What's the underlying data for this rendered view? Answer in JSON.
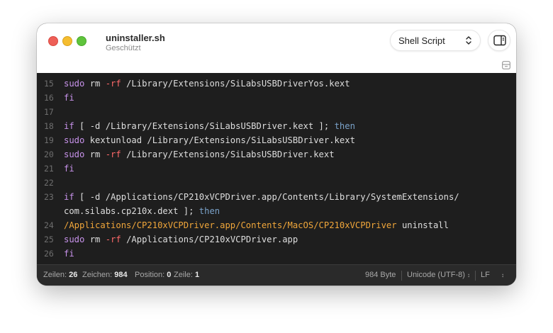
{
  "window": {
    "title": "uninstaller.sh",
    "subtitle": "Geschützt"
  },
  "toolbar": {
    "language": "Shell Script",
    "chevron_icon": "up-down-chevron-icon",
    "sidebar_icon": "sidebar-toggle-icon"
  },
  "editor": {
    "lines": [
      {
        "num": "15",
        "tokens": [
          [
            "kw",
            "sudo"
          ],
          [
            "txt",
            " rm "
          ],
          [
            "opt",
            "-rf"
          ],
          [
            "txt",
            " /Library/Extensions/SiLabsUSBDriverYos.kext"
          ]
        ]
      },
      {
        "num": "16",
        "tokens": [
          [
            "kw",
            "fi"
          ]
        ]
      },
      {
        "num": "17",
        "tokens": []
      },
      {
        "num": "18",
        "tokens": [
          [
            "kw",
            "if"
          ],
          [
            "txt",
            " [ -d /Library/Extensions/SiLabsUSBDriver.kext ]; "
          ],
          [
            "kw2",
            "then"
          ]
        ]
      },
      {
        "num": "19",
        "tokens": [
          [
            "kw",
            "sudo"
          ],
          [
            "txt",
            " kextunload /Library/Extensions/SiLabsUSBDriver.kext"
          ]
        ]
      },
      {
        "num": "20",
        "tokens": [
          [
            "kw",
            "sudo"
          ],
          [
            "txt",
            " rm "
          ],
          [
            "opt",
            "-rf"
          ],
          [
            "txt",
            " /Library/Extensions/SiLabsUSBDriver.kext"
          ]
        ]
      },
      {
        "num": "21",
        "tokens": [
          [
            "kw",
            "fi"
          ]
        ]
      },
      {
        "num": "22",
        "tokens": []
      },
      {
        "num": "23",
        "tokens": [
          [
            "kw",
            "if"
          ],
          [
            "txt",
            " [ -d /Applications/CP210xVCPDriver.app/Contents/Library/SystemExtensions/"
          ]
        ]
      },
      {
        "num": "",
        "tokens": [
          [
            "txt",
            "com.silabs.cp210x.dext ]; "
          ],
          [
            "kw2",
            "then"
          ]
        ]
      },
      {
        "num": "24",
        "tokens": [
          [
            "cmd",
            "/Applications/CP210xVCPDriver.app/Contents/MacOS/CP210xVCPDriver"
          ],
          [
            "txt",
            " uninstall"
          ]
        ]
      },
      {
        "num": "25",
        "tokens": [
          [
            "kw",
            "sudo"
          ],
          [
            "txt",
            " rm "
          ],
          [
            "opt",
            "-rf"
          ],
          [
            "txt",
            " /Applications/CP210xVCPDriver.app"
          ]
        ]
      },
      {
        "num": "26",
        "tokens": [
          [
            "kw",
            "fi"
          ]
        ]
      }
    ]
  },
  "status": {
    "lines_label": "Zeilen: ",
    "lines_value": "26",
    "chars_label": "Zeichen: ",
    "chars_value": "984",
    "pos_label": "Position: ",
    "pos_value": "0",
    "row_label": "Zeile: ",
    "row_value": "1",
    "size": "984 Byte",
    "encoding": "Unicode (UTF-8)",
    "line_ending": "LF"
  },
  "colors": {
    "keyword": "#c792ea",
    "then": "#7aa2c9",
    "command_path": "#f0a63a",
    "option": "#ff6a6a"
  }
}
